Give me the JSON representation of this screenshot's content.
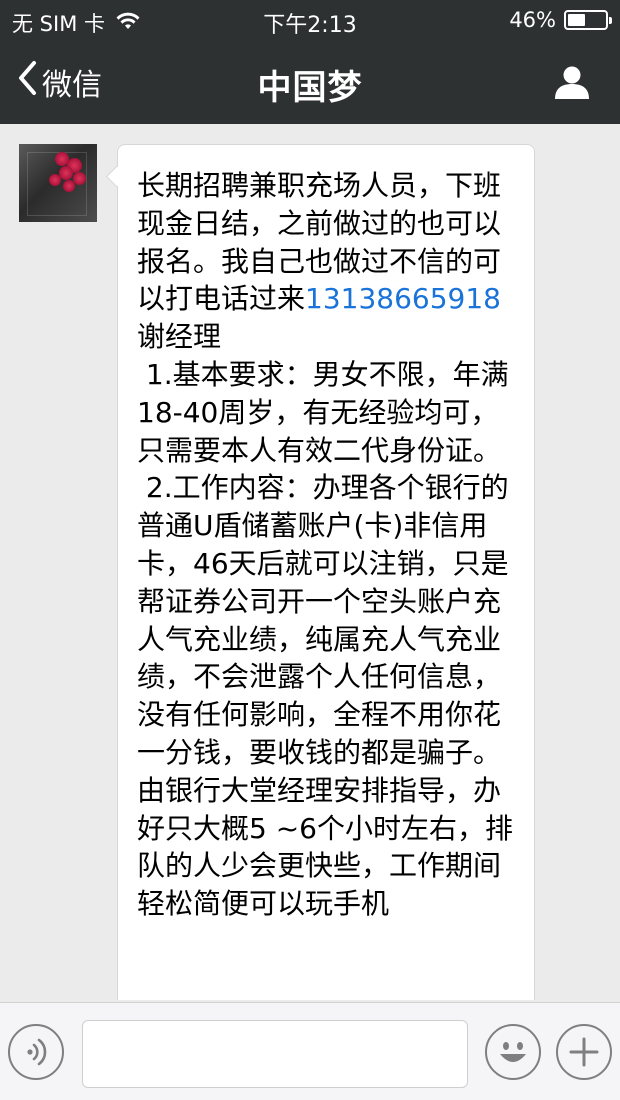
{
  "status_bar": {
    "carrier": "无 SIM 卡",
    "time": "下午2:13",
    "battery": "46%",
    "battery_level": 0.46
  },
  "nav": {
    "back_label": "微信",
    "title": "中国梦"
  },
  "message": {
    "text_before_phone": "长期招聘兼职充场人员，下班现金日结，之前做过的也可以报名。我自己也做过不信的可以打电话过来",
    "phone": "13138665918",
    "text_after_phone": "谢经理\n 1.基本要求：男女不限，年满18-40周岁，有无经验均可，只需要本人有效二代身份证。\n 2.工作内容：办理各个银行的普通U盾储蓄账户(卡)非信用卡，46天后就可以注销，只是帮证券公司开一个空头账户充人气充业绩，纯属充人气充业绩，不会泄露个人任何信息，没有任何影响，全程不用你花一分钱，要收钱的都是骗子。由银行大堂经理安排指导，办好只大概5 ~6个小时左右，排队的人少会更快些，工作期间轻松简便可以玩手机"
  },
  "input_bar": {
    "placeholder": ""
  }
}
